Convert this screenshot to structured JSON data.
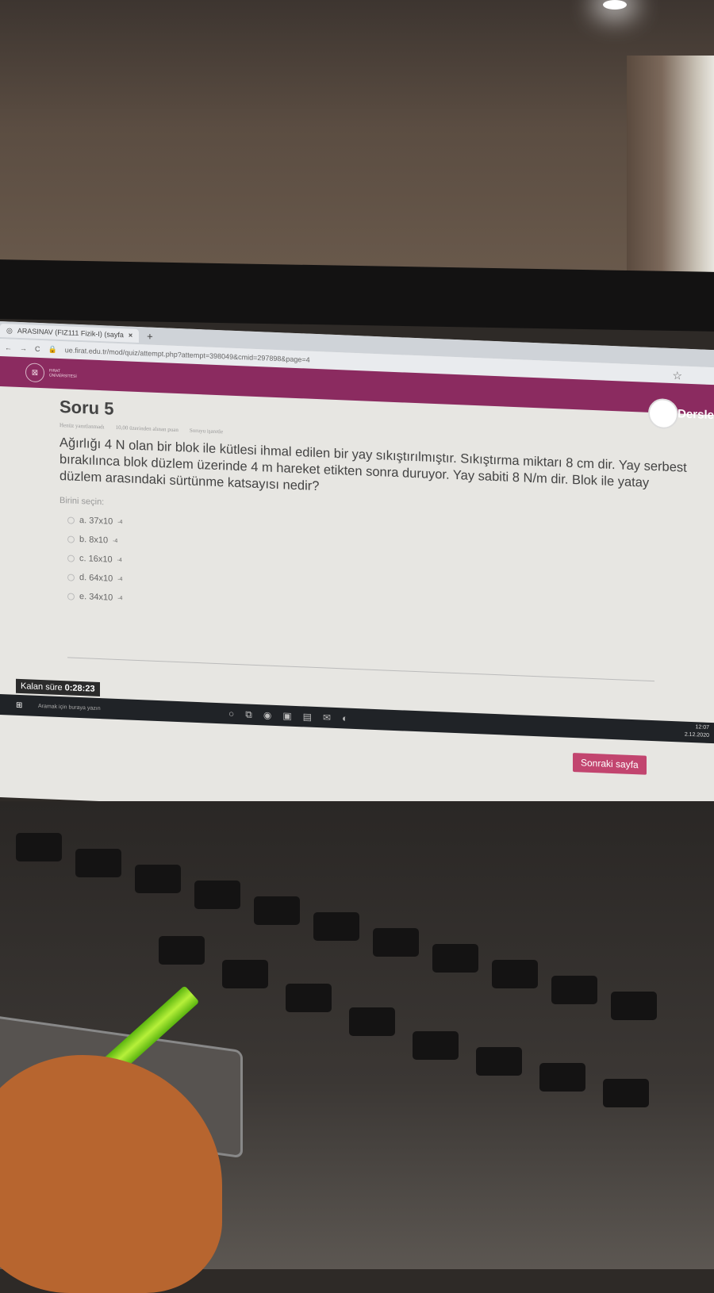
{
  "browser": {
    "tab_title": "ARASINAV (FIZ111 Fizik-I) (sayfa",
    "tab_close": "×",
    "new_tab": "+",
    "url": "ue.firat.edu.tr/mod/quiz/attempt.php?attempt=398049&cmid=297898&page=4"
  },
  "site": {
    "logo_text_1": "FIRAT",
    "logo_text_2": "ÜNİVERSİTESİ",
    "user_menu": "Dersle"
  },
  "question": {
    "title": "Soru 5",
    "status": "Henüz yanıtlanmadı",
    "points": "10,00 üzerinden alınan puan",
    "flag": "Soruyu işaretle",
    "text": "Ağırlığı 4 N olan bir blok ile kütlesi ihmal edilen bir yay sıkıştırılmıştır. Sıkıştırma miktarı 8 cm dir. Yay serbest bırakılınca blok düzlem üzerinde 4 m hareket etikten sonra duruyor. Yay sabiti 8 N/m dir. Blok ile yatay düzlem arasındaki sürtünme katsayısı nedir?",
    "prompt": "Birini seçin:",
    "options": [
      {
        "label": "a. 37x10",
        "exp": "-4"
      },
      {
        "label": "b. 8x10",
        "exp": "-4"
      },
      {
        "label": "c. 16x10",
        "exp": "-4"
      },
      {
        "label": "d. 64x10",
        "exp": "-4"
      },
      {
        "label": "e. 34x10",
        "exp": "-4"
      }
    ]
  },
  "timer": {
    "label": "Kalan süre",
    "value": "0:28:23"
  },
  "nav": {
    "next": "Sonraki sayfa"
  },
  "taskbar": {
    "search_placeholder": "Aramak için buraya yazın",
    "time": "12:07",
    "date": "2.12.2020"
  }
}
